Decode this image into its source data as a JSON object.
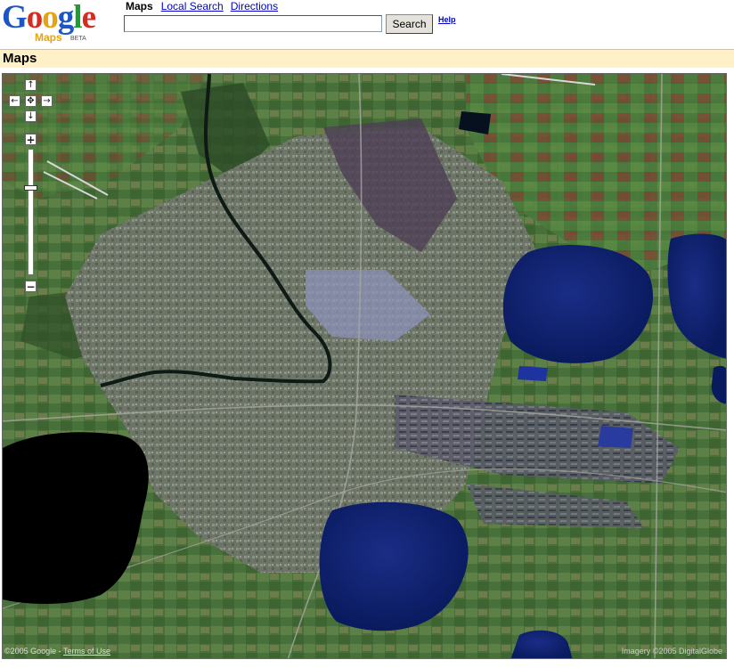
{
  "logo": {
    "letters": [
      "G",
      "o",
      "o",
      "g",
      "l",
      "e"
    ],
    "product": "Maps",
    "beta": "BETA"
  },
  "nav": {
    "current": "Maps",
    "links": [
      "Local Search",
      "Directions"
    ]
  },
  "search": {
    "value": "",
    "button_label": "Search",
    "help_label": "Help"
  },
  "title": "Maps",
  "map": {
    "controls": {
      "pan_up": "↑",
      "pan_left": "←",
      "pan_center": "✥",
      "pan_right": "→",
      "pan_down": "↓",
      "zoom_in": "+",
      "zoom_out": "−",
      "zoom_level_fraction": 0.3
    },
    "copyright_prefix": "©2005 Google - ",
    "terms_label": "Terms of Use",
    "imagery": "Imagery ©2005 DigitalGlobe"
  },
  "colors": {
    "link": "#0000cc",
    "titlebar": "#fff0c8",
    "water": "#0a1f6e"
  }
}
